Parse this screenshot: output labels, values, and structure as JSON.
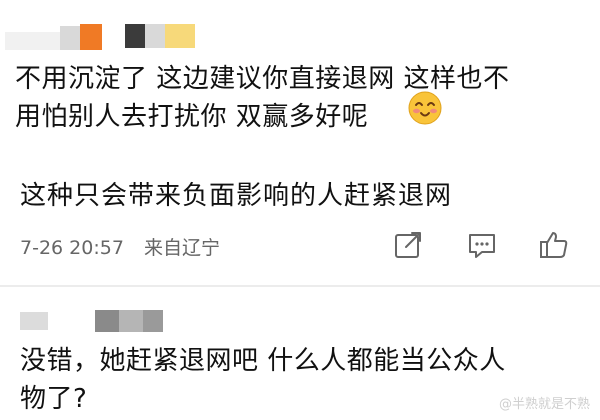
{
  "quoted_comment": {
    "line1": "不用沉淀了 这边建议你直接退网 这样也不",
    "line2": "用怕别人去打扰你 双赢多好呢",
    "emoji": "smiling-blush-emoji"
  },
  "comment": {
    "text": "这种只会带来负面影响的人赶紧退网",
    "timestamp": "7-26 20:57",
    "location": "来自辽宁",
    "actions": [
      "share-icon",
      "comment-icon",
      "like-icon"
    ]
  },
  "reply": {
    "line1": "没错，她赶紧退网吧  什么人都能当公众人",
    "line2": "物了?"
  },
  "watermark": "@半熟就是不熟",
  "colors": {
    "meta": "#666666",
    "divider": "#ececec",
    "redact_orange": "#f07a25"
  }
}
